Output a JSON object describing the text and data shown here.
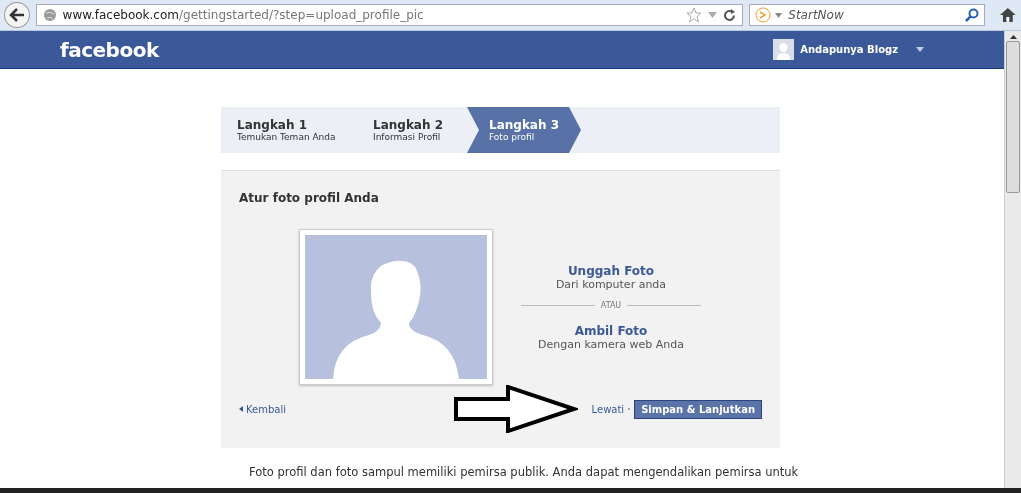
{
  "browser": {
    "url_host": "www.facebook.com",
    "url_path": "/gettingstarted/?step=upload_profile_pic",
    "search_placeholder": "StartNow"
  },
  "header": {
    "logo": "facebook",
    "user_name": "Andapunya Blogz"
  },
  "steps": [
    {
      "title": "Langkah 1",
      "subtitle": "Temukan Teman Anda",
      "selected": false
    },
    {
      "title": "Langkah 2",
      "subtitle": "Informasi Profil",
      "selected": false
    },
    {
      "title": "Langkah 3",
      "subtitle": "Foto profil",
      "selected": true
    }
  ],
  "panel": {
    "title": "Atur foto profil Anda",
    "options": [
      {
        "title": "Unggah Foto",
        "subtitle": "Dari komputer anda"
      },
      {
        "title": "Ambil Foto",
        "subtitle": "Dengan kamera web Anda"
      }
    ],
    "separator": "ATAU",
    "back": "Kembali",
    "skip": "Lewati",
    "save": "Simpan & Lanjutkan"
  },
  "tip": "Foto profil dan foto sampul memiliki pemirsa publik. Anda dapat mengendalikan pemirsa untuk"
}
